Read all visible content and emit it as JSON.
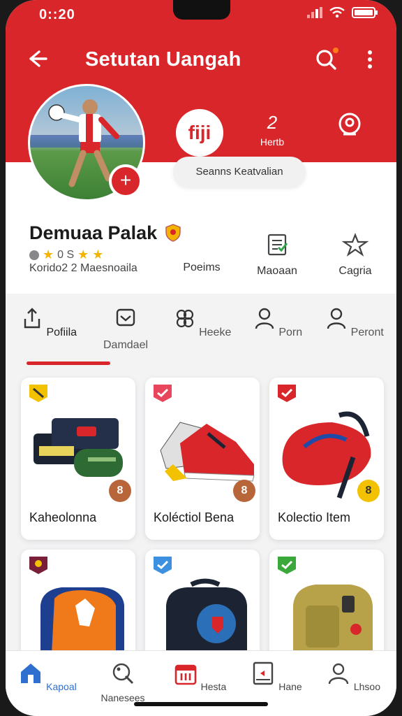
{
  "status": {
    "time": "0::20"
  },
  "header": {
    "title": "Setutan Uangah"
  },
  "profile": {
    "stat_primary": "fiji",
    "stat_count": "2",
    "stat_count_label": "Hertb",
    "pill_text": "Seanns  Keatvalian",
    "name": "Demuaa Palak",
    "rating_text": "0 S",
    "subline": "Korido2 2 Maesnoaila",
    "metrics": [
      {
        "label": "Poeims",
        "icon": "none"
      },
      {
        "label": "Maoaan",
        "icon": "document-check-icon"
      },
      {
        "label": "Cagria",
        "icon": "sparkle-icon"
      }
    ]
  },
  "tabs": [
    {
      "label": "Pofiila",
      "icon": "share-icon"
    },
    {
      "label": "Damdael",
      "icon": "inbox-icon"
    },
    {
      "label": "Heeke",
      "icon": "group-icon"
    },
    {
      "label": "Porn",
      "icon": "user-icon"
    },
    {
      "label": "Peront",
      "icon": "user-icon"
    }
  ],
  "products": [
    {
      "label": "Kaheolonna",
      "badge": "8",
      "badge_color": "#b8653a",
      "tag_color": "#f2c200"
    },
    {
      "label": "Koléctiol Bena",
      "badge": "8",
      "badge_color": "#b8653a",
      "tag_color": "#e8465c"
    },
    {
      "label": "Kolectio Item",
      "badge": "8",
      "badge_color": "#f2c200",
      "tag_color": "#d9262a"
    },
    {
      "label": "",
      "badge": "",
      "badge_color": "#b8653a",
      "tag_color": "#7a1f3a"
    },
    {
      "label": "",
      "badge": "",
      "badge_color": "#b8653a",
      "tag_color": "#3d8fe0"
    },
    {
      "label": "",
      "badge": "",
      "badge_color": "#b8653a",
      "tag_color": "#3aa83a"
    }
  ],
  "nav": [
    {
      "label": "Kapoal",
      "icon": "home-icon",
      "active": true
    },
    {
      "label": "Nanesees",
      "icon": "tag-icon"
    },
    {
      "label": "Hesta",
      "icon": "calendar-icon"
    },
    {
      "label": "Hane",
      "icon": "tablet-icon"
    },
    {
      "label": "Lhsoo",
      "icon": "user-icon"
    }
  ],
  "colors": {
    "brand_red": "#d9262a",
    "active_blue": "#2f6fd0"
  }
}
